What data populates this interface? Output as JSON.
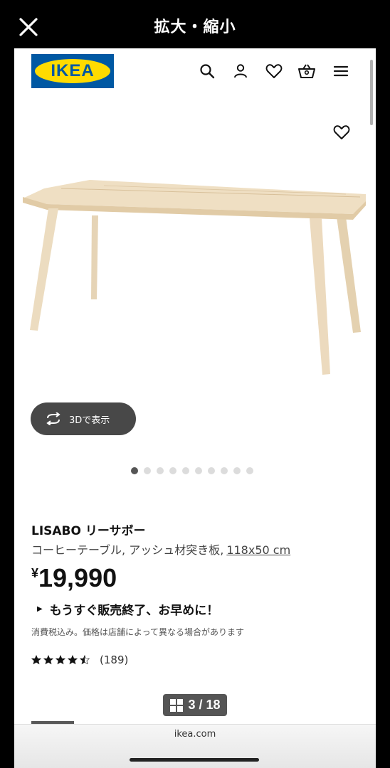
{
  "viewer": {
    "title": "拡大・縮小",
    "page_indicator": "3 / 18"
  },
  "header": {
    "logo_text": "IKEA",
    "icons": [
      "search-icon",
      "account-icon",
      "heart-icon",
      "cart-icon",
      "menu-icon"
    ]
  },
  "product": {
    "name": "LISABO リーサボー",
    "description": "コーヒーテーブル, アッシュ材突き板,",
    "size": "118x50 cm",
    "price_currency": "¥",
    "price_amount": "19,990",
    "notice": "もうすぐ販売終了、お早めに！",
    "tax_note": "消費税込み。価格は店舗によって異なる場合があります",
    "rating_value": 4.5,
    "rating_count": "(189)",
    "view3d_label": "3Dで表示"
  },
  "carousel": {
    "total_dots": 10,
    "active_index": 0
  },
  "browser": {
    "url": "ikea.com"
  },
  "colors": {
    "ikea_blue": "#0058a3",
    "ikea_yellow": "#ffdb00",
    "button_dark": "#484848"
  }
}
